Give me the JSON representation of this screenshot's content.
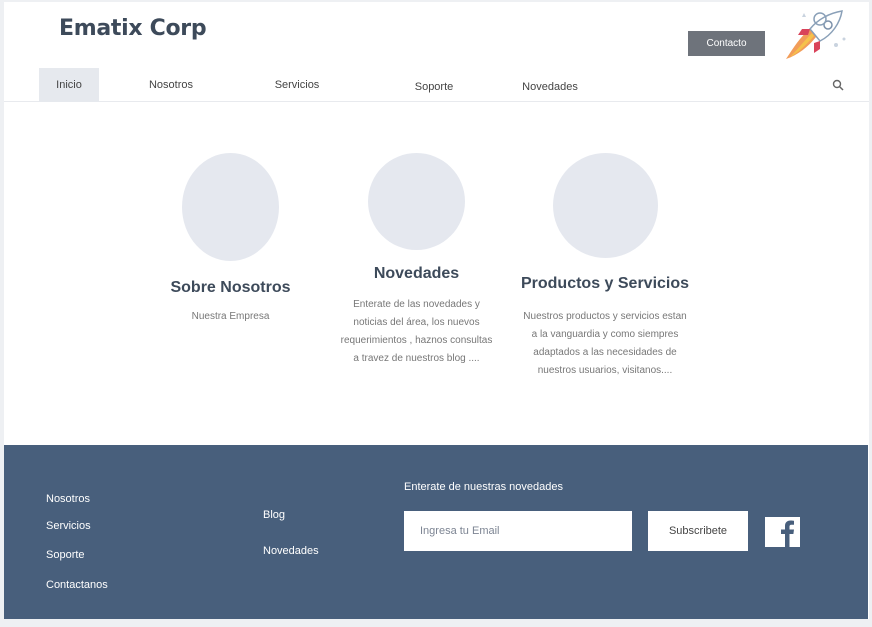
{
  "header": {
    "brand": "Ematix Corp",
    "contact_button": "Contacto",
    "logo_icon": "rocket-icon"
  },
  "nav": {
    "items": [
      {
        "label": "Inicio",
        "active": true
      },
      {
        "label": "Nosotros",
        "active": false
      },
      {
        "label": "Servicios",
        "active": false
      },
      {
        "label": "Soporte",
        "active": false
      },
      {
        "label": "Novedades",
        "active": false
      }
    ],
    "search_icon": "search-icon"
  },
  "features": [
    {
      "title": "Sobre Nosotros",
      "description": "Nuestra Empresa"
    },
    {
      "title": "Novedades",
      "description": "Enterate de las novedades y noticias del área, los nuevos requerimientos , haznos consultas a travez de nuestros blog ...."
    },
    {
      "title": "Productos y Servicios",
      "description": "Nuestros productos y servicios estan a la vanguardia y como siempres adaptados a las necesidades de nuestros usuarios, visitanos...."
    }
  ],
  "footer": {
    "col1": [
      "Nosotros",
      "Servicios",
      "Soporte",
      "Contactanos"
    ],
    "col2": [
      "Blog",
      "Novedades"
    ],
    "newsletter_title": "Enterate de nuestras novedades",
    "email_placeholder": "Ingresa tu Email",
    "subscribe_button": "Subscribete",
    "social_icon": "facebook-icon"
  },
  "colors": {
    "footer_bg": "#485f7c",
    "accent_dark": "#3d4a5a",
    "circle": "#e5e8ef",
    "nav_active": "#e6e9ee",
    "contact_button": "#6e737b"
  }
}
